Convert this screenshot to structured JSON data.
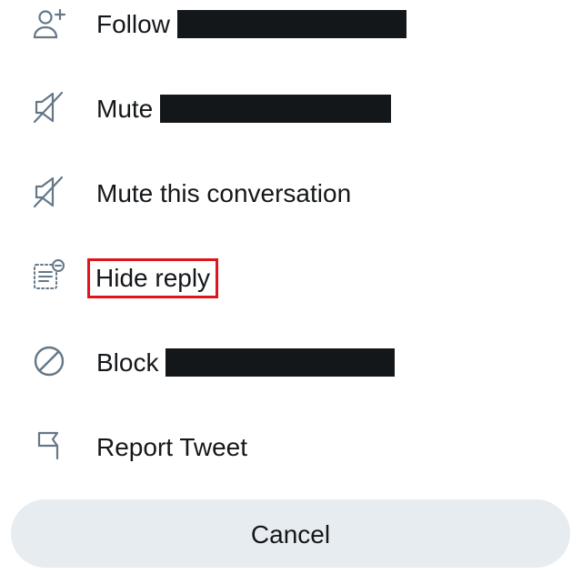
{
  "menu": {
    "items": [
      {
        "label": "Follow",
        "icon": "follow-user-icon",
        "redacted_name": true,
        "highlighted": false
      },
      {
        "label": "Mute",
        "icon": "mute-icon",
        "redacted_name": true,
        "highlighted": false
      },
      {
        "label": "Mute this conversation",
        "icon": "mute-conversation-icon",
        "redacted_name": false,
        "highlighted": false
      },
      {
        "label": "Hide reply",
        "icon": "hide-reply-icon",
        "redacted_name": false,
        "highlighted": true
      },
      {
        "label": "Block",
        "icon": "block-icon",
        "redacted_name": true,
        "highlighted": false
      },
      {
        "label": "Report Tweet",
        "icon": "flag-icon",
        "redacted_name": false,
        "highlighted": false
      }
    ]
  },
  "cancel_label": "Cancel",
  "colors": {
    "icon_gray": "#657786",
    "text": "#14171a",
    "cancel_bg": "#e6ecf0",
    "highlight_red": "#e0141c",
    "redaction": "#14171a"
  }
}
